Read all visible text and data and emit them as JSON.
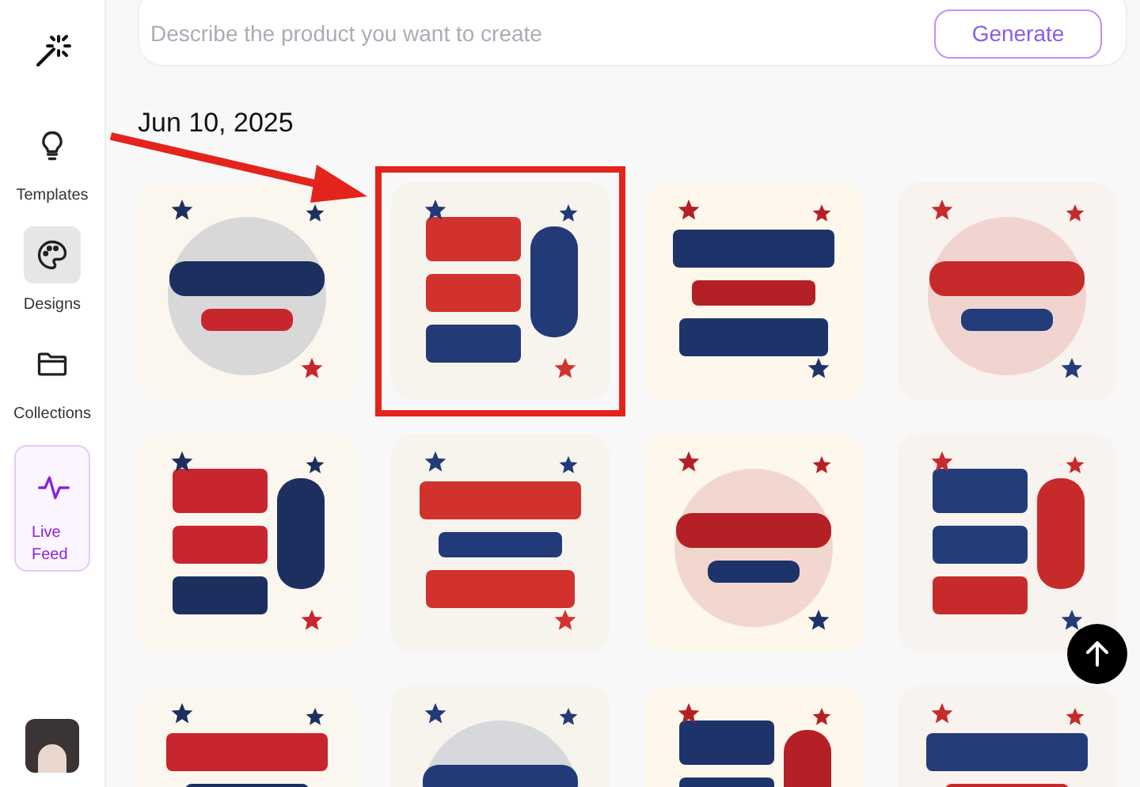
{
  "sidebar": {
    "items": [
      {
        "label": "Templates",
        "selected": false,
        "kind": "plain"
      },
      {
        "label": "Designs",
        "selected": true,
        "kind": "plain"
      },
      {
        "label": "Collections",
        "selected": false,
        "kind": "plain"
      },
      {
        "label": "Live Feed",
        "selected": false,
        "kind": "featured"
      }
    ]
  },
  "prompt": {
    "placeholder": "Describe the product you want to create",
    "button": "Generate"
  },
  "date_heading": "Jun 10, 2025",
  "designs": [
    {
      "kind": "picture",
      "highlighted": false
    },
    {
      "kind": "picture",
      "highlighted": true
    },
    {
      "kind": "picture",
      "highlighted": false
    },
    {
      "kind": "picture",
      "highlighted": false
    },
    {
      "kind": "picture",
      "highlighted": false
    },
    {
      "kind": "picture",
      "highlighted": false
    },
    {
      "kind": "picture",
      "highlighted": false
    },
    {
      "kind": "picture",
      "highlighted": false
    },
    {
      "kind": "picture",
      "highlighted": false
    },
    {
      "kind": "picture",
      "highlighted": false
    },
    {
      "kind": "picture",
      "highlighted": false
    },
    {
      "kind": "picture",
      "highlighted": false
    }
  ]
}
